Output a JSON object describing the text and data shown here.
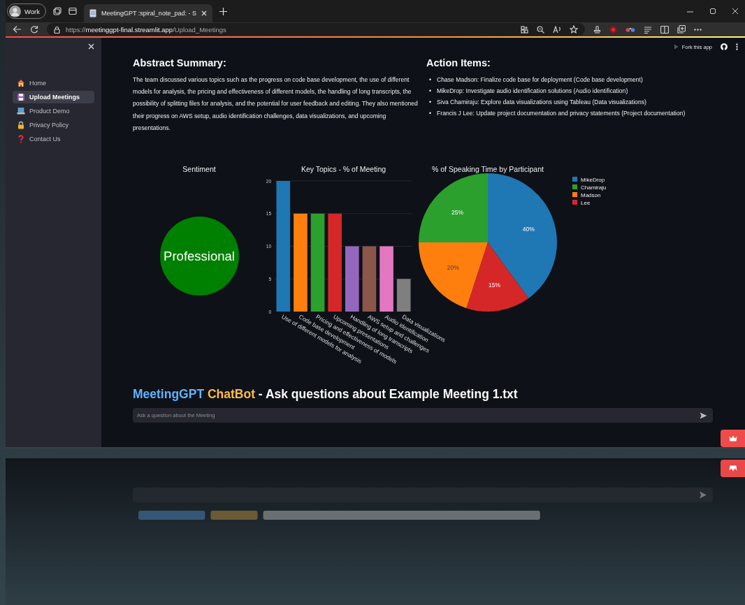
{
  "browser": {
    "profile": "Work",
    "tab_title": "MeetingGPT :spiral_note_pad: - S",
    "url": "https://**meetinggpt-final.streamlit.app**/Upload_Meetings"
  },
  "sidebar": {
    "items": [
      {
        "label": "Home",
        "selected": false
      },
      {
        "label": "Upload Meetings",
        "selected": true
      },
      {
        "label": "Product Demo",
        "selected": false
      },
      {
        "label": "Privacy Policy",
        "selected": false
      },
      {
        "label": "Contact Us",
        "selected": false
      }
    ]
  },
  "toolbar": {
    "fork_label": "Fork this app"
  },
  "abstract": {
    "heading": "Abstract Summary:",
    "text": "The team discussed various topics such as the progress on code base development, the use of different models for analysis, the pricing and effectiveness of different models, the handling of long transcripts, the possibility of splitting files for analysis, and the potential for user feedback and editing. They also mentioned their progress on AWS setup, audio identification challenges, data visualizations, and upcoming presentations."
  },
  "action_items": {
    "heading": "Action Items:",
    "items": [
      {
        "marker": "•",
        "text": "Chase Madson: Finalize code base for deployment (Code base development)"
      },
      {
        "marker": "•",
        "text": "MikeDrop: Investigate audio identification solutions (Audio identification)"
      },
      {
        "marker": "•",
        "text": "Siva Chamiraju: Explore data visualizations using Tableau (Data visualizations)"
      },
      {
        "marker": "•",
        "text": "Francis J Lee: Update project documentation and privacy statements (Project documentation)"
      }
    ]
  },
  "sentiment": {
    "title": "Sentiment",
    "label": "Professional"
  },
  "key_topics": {
    "chart_data": {
      "type": "bar",
      "title": "Key Topics - % of Meeting",
      "categories": [
        "Use of different models for analysis",
        "Code base development",
        "Pricing and effectiveness of models",
        "Upcoming presentations",
        "Handling of long transcripts",
        "AWS setup and challenges",
        "Audio identification",
        "Data visualizations"
      ],
      "values": [
        20,
        15,
        15,
        15,
        10,
        10,
        10,
        5
      ],
      "colors": [
        "#1f77b4",
        "#ff7f0e",
        "#2ca02c",
        "#d62728",
        "#9467bd",
        "#8c564b",
        "#e377c2",
        "#7f7f7f"
      ],
      "ylim": [
        0,
        20
      ],
      "yticks": [
        0,
        5,
        10,
        15,
        20
      ],
      "grid": true
    }
  },
  "speaking_time": {
    "chart_data": {
      "type": "pie",
      "title": "% of Speaking Time by Participant",
      "categories": [
        "MikeDrop",
        "Chamiraju",
        "Madson",
        "Lee"
      ],
      "values": [
        40,
        25,
        20,
        15
      ],
      "colors": [
        "#1f77b4",
        "#2ca02c",
        "#ff7f0e",
        "#d62728"
      ],
      "value_labels": [
        "40%",
        "25%",
        "20%",
        "15%"
      ],
      "legend": "right"
    }
  },
  "chatbot": {
    "title_parts": [
      {
        "text": "MeetingGPT ",
        "color": "#60b4ff"
      },
      {
        "text": "ChatBot ",
        "color": "#ffbd45"
      },
      {
        "text": "- Ask questions about Example Meeting 1.txt",
        "color": "#fafafa"
      }
    ],
    "placeholder": "Ask a question about the Meeting"
  }
}
